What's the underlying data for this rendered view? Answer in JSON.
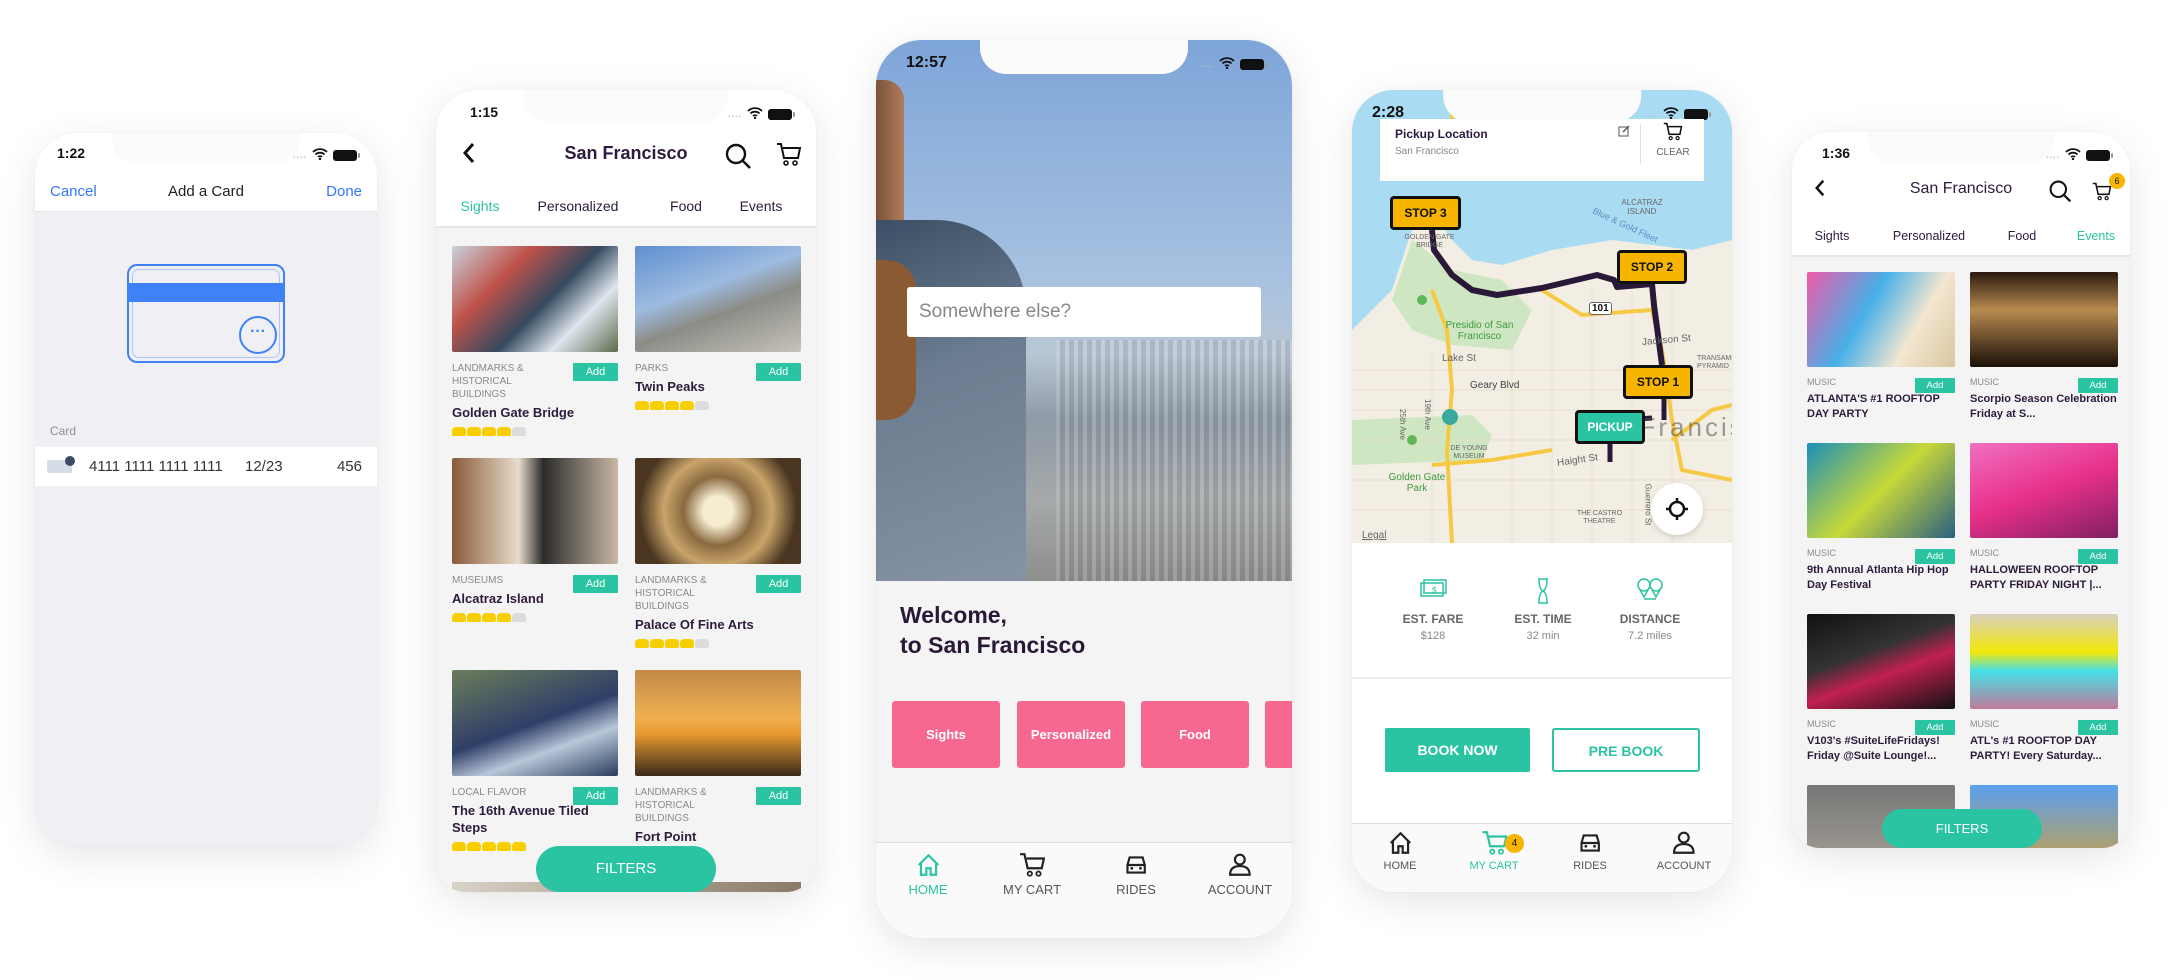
{
  "colors": {
    "accent": "#2bc4a2",
    "pink": "#f76891",
    "yellow": "#f7b500",
    "ios_blue": "#3478f6",
    "text_dark": "#2d1b3d"
  },
  "add_card": {
    "time": "1:22",
    "cancel": "Cancel",
    "title": "Add a Card",
    "done": "Done",
    "section_label": "Card",
    "card_number": "4111 1111 1111 1111",
    "expiry": "12/23",
    "cvc": "456"
  },
  "sights": {
    "time": "1:15",
    "title": "San Francisco",
    "tabs": [
      {
        "label": "Sights",
        "active": true
      },
      {
        "label": "Personalized"
      },
      {
        "label": "Food"
      },
      {
        "label": "Events"
      }
    ],
    "add_label": "Add",
    "cards": [
      {
        "category": "Landmarks & Historical Buildings",
        "title": "Golden Gate Bridge",
        "rating": 4
      },
      {
        "category": "Parks",
        "title": "Twin Peaks",
        "rating": 4
      },
      {
        "category": "Museums",
        "title": "Alcatraz Island",
        "rating": 4
      },
      {
        "category": "Landmarks & Historical Buildings",
        "title": "Palace Of Fine Arts",
        "rating": 4
      },
      {
        "category": "Local Flavor",
        "title": "The 16th Avenue Tiled Steps",
        "rating": 5
      },
      {
        "category": "Landmarks & Historical Buildings",
        "title": "Fort Point"
      }
    ],
    "filters": "FILTERS"
  },
  "home": {
    "time": "12:57",
    "search_placeholder": "Somewhere else?",
    "welcome_line1": "Welcome,",
    "welcome_line2": "to San Francisco",
    "categories": [
      "Sights",
      "Personalized",
      "Food",
      ""
    ],
    "tabbar": [
      {
        "label": "HOME",
        "icon": "home-icon",
        "active": true
      },
      {
        "label": "MY CART",
        "icon": "cart-icon"
      },
      {
        "label": "RIDES",
        "icon": "car-icon"
      },
      {
        "label": "ACCOUNT",
        "icon": "person-icon"
      }
    ]
  },
  "rides": {
    "time": "2:28",
    "pickup_title": "Pickup Location",
    "pickup_value": "San Francisco",
    "clear": "CLEAR",
    "markers": [
      "STOP 3",
      "STOP 2",
      "STOP 1",
      "PICKUP"
    ],
    "map_labels": [
      "ALCATRAZ ISLAND",
      "Blue & Gold Fleet",
      "GOLDEN GATE BRIDGE",
      "Presidio of San Francisco",
      "Lake St",
      "Geary Blvd",
      "Golden Gate Park",
      "DE YOUNG MUSEUM",
      "Haight St",
      "THE CASTRO THEATRE",
      "Jackson St",
      "TRANSAMERICA PYRAMID",
      "Guerrero St",
      "25th Ave",
      "19th Ave",
      "101",
      "Legal",
      "San Francisco"
    ],
    "stats": [
      {
        "label": "EST. FARE",
        "value": "$128",
        "icon": "money-icon"
      },
      {
        "label": "EST. TIME",
        "value": "32 min",
        "icon": "hourglass-icon"
      },
      {
        "label": "DISTANCE",
        "value": "7.2 miles",
        "icon": "pins-icon"
      }
    ],
    "book_now": "BOOK NOW",
    "pre_book": "PRE BOOK",
    "cart_badge": "4",
    "tabbar": [
      {
        "label": "HOME",
        "icon": "home-icon"
      },
      {
        "label": "MY CART",
        "icon": "cart-icon",
        "active": true
      },
      {
        "label": "RIDES",
        "icon": "car-icon"
      },
      {
        "label": "ACCOUNT",
        "icon": "person-icon"
      }
    ]
  },
  "events": {
    "time": "1:36",
    "title": "San Francisco",
    "cart_badge": "6",
    "tabs": [
      {
        "label": "Sights"
      },
      {
        "label": "Personalized"
      },
      {
        "label": "Food"
      },
      {
        "label": "Events",
        "active": true
      }
    ],
    "add_label": "Add",
    "cards": [
      {
        "category": "Music",
        "title": " ATLANTA'S #1 ROOFTOP DAY PARTY"
      },
      {
        "category": "Music",
        "title": "Scorpio Season Celebration Friday at S..."
      },
      {
        "category": "Music",
        "title": "9th Annual Atlanta Hip Hop Day Festival"
      },
      {
        "category": "Music",
        "title": "HALLOWEEN ROOFTOP PARTY FRIDAY NIGHT |..."
      },
      {
        "category": "Music",
        "title": "V103's #SuiteLifeFridays! Friday @Suite Lounge!..."
      },
      {
        "category": "Music",
        "title": "ATL's #1 ROOFTOP DAY PARTY! Every Saturday..."
      },
      {},
      {}
    ],
    "filters": "FILTERS"
  }
}
